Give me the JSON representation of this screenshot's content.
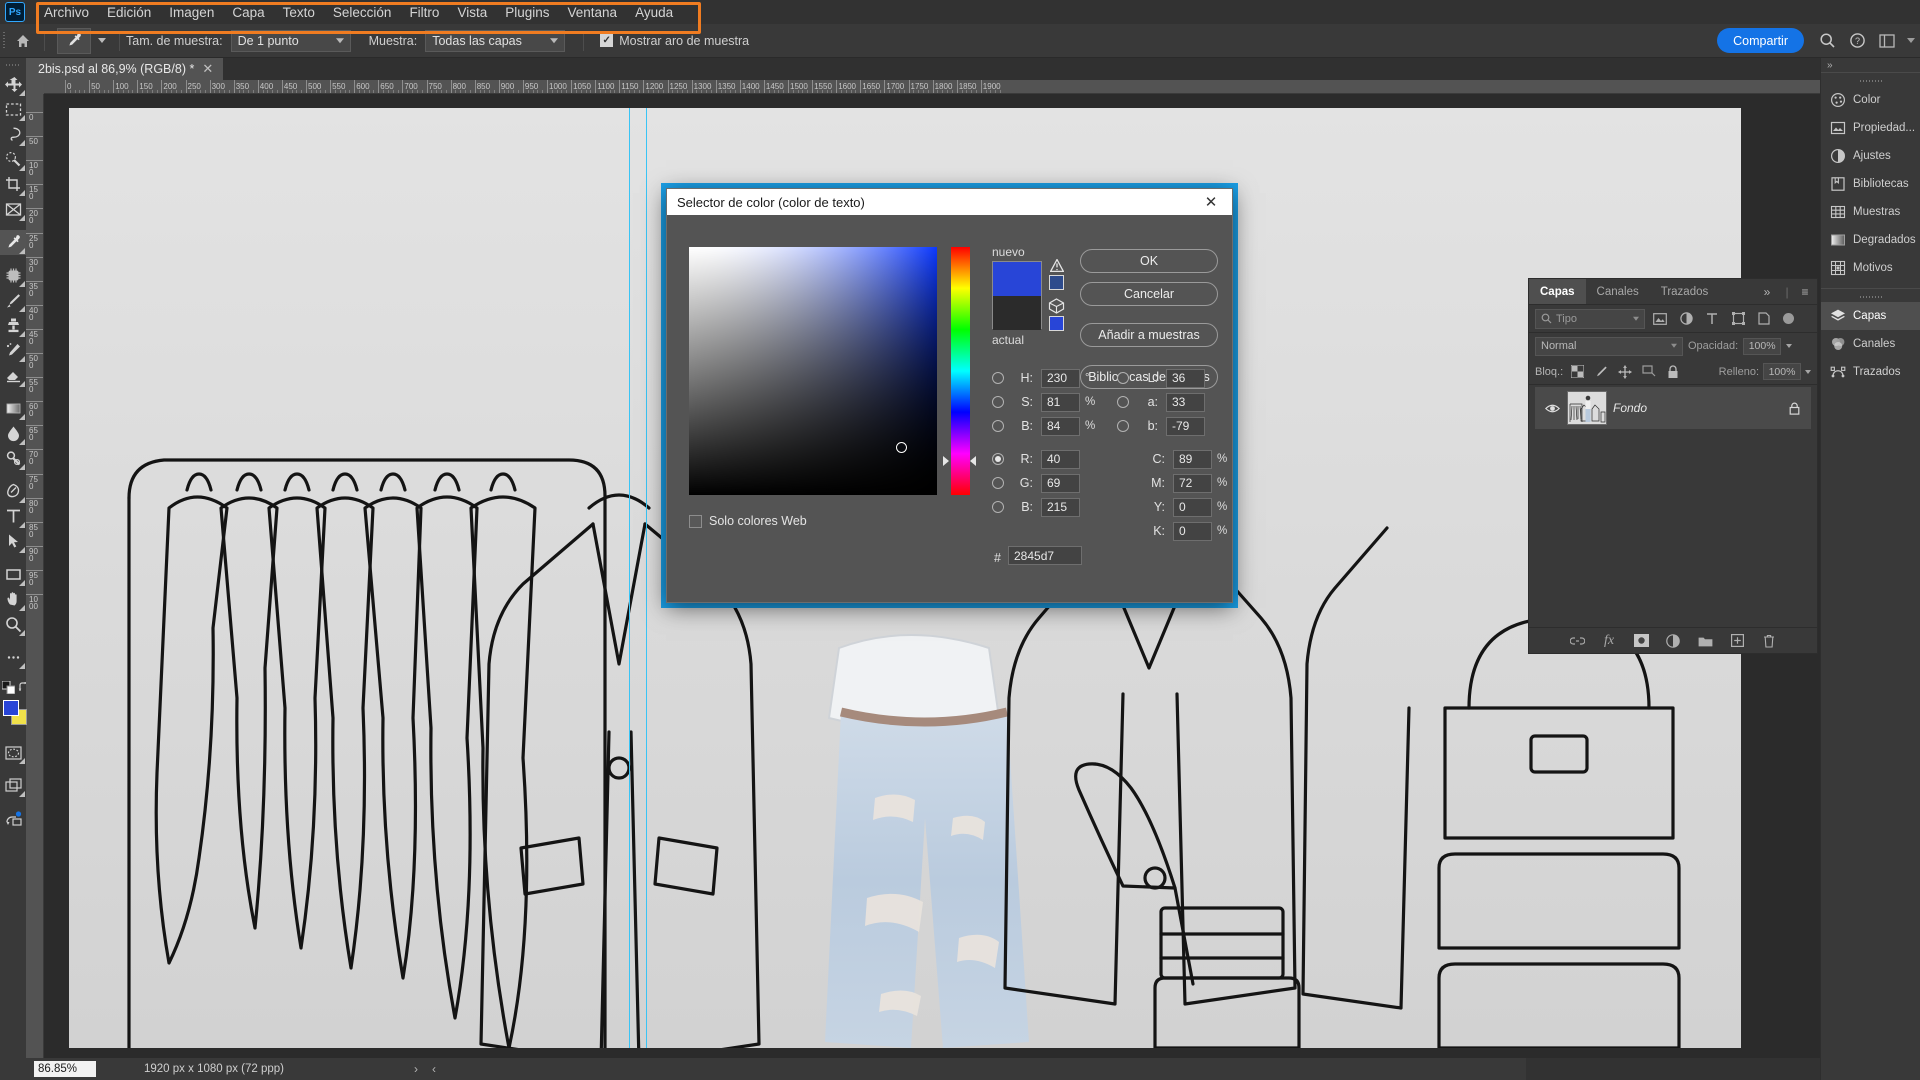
{
  "app": {
    "logo": "Ps"
  },
  "menubar": {
    "items": [
      {
        "label": "Archivo"
      },
      {
        "label": "Edición"
      },
      {
        "label": "Imagen"
      },
      {
        "label": "Capa"
      },
      {
        "label": "Texto"
      },
      {
        "label": "Selección"
      },
      {
        "label": "Filtro"
      },
      {
        "label": "Vista"
      },
      {
        "label": "Plugins"
      },
      {
        "label": "Ventana"
      },
      {
        "label": "Ayuda"
      }
    ]
  },
  "options_bar": {
    "tool": "eyedropper-tool",
    "sample_size_label": "Tam. de muestra:",
    "sample_size_value": "De 1 punto",
    "sample_label": "Muestra:",
    "sample_value": "Todas las capas",
    "show_ring_label": "Mostrar aro de muestra",
    "show_ring_checked": true,
    "share_label": "Compartir",
    "highlight_color": "#f07c21"
  },
  "document": {
    "tab_title": "2bis.psd al 86,9% (RGB/8) *",
    "close_glyph": "✕"
  },
  "rulers": {
    "horizontal_ticks": [
      "0",
      "50",
      "100",
      "150",
      "200",
      "250",
      "300",
      "350",
      "400",
      "450",
      "500",
      "550",
      "600",
      "650",
      "700",
      "750",
      "800",
      "850",
      "900",
      "950",
      "1000",
      "1050",
      "1100",
      "1150",
      "1200",
      "1250",
      "1300",
      "1350",
      "1400",
      "1450",
      "1500",
      "1550",
      "1600",
      "1650",
      "1700",
      "1750",
      "1800",
      "1850",
      "1900"
    ],
    "vertical_ticks": [
      "0",
      "50",
      "100",
      "150",
      "200",
      "250",
      "300",
      "350",
      "400",
      "450",
      "500",
      "550",
      "600",
      "650",
      "700",
      "750",
      "800",
      "850",
      "900",
      "950",
      "1000"
    ]
  },
  "toolbar": {
    "tools": [
      {
        "name": "move-tool",
        "selected": false
      },
      {
        "name": "rectangular-marquee-tool",
        "selected": false
      },
      {
        "name": "lasso-tool",
        "selected": false
      },
      {
        "name": "quick-selection-tool",
        "selected": false
      },
      {
        "name": "crop-tool",
        "selected": false
      },
      {
        "name": "frame-tool",
        "selected": false
      },
      {
        "name": "eyedropper-tool",
        "selected": true
      },
      {
        "name": "spot-healing-brush-tool",
        "selected": false
      },
      {
        "name": "brush-tool",
        "selected": false
      },
      {
        "name": "clone-stamp-tool",
        "selected": false
      },
      {
        "name": "history-brush-tool",
        "selected": false
      },
      {
        "name": "eraser-tool",
        "selected": false
      },
      {
        "name": "gradient-tool",
        "selected": false
      },
      {
        "name": "blur-tool",
        "selected": false
      },
      {
        "name": "dodge-tool",
        "selected": false
      },
      {
        "name": "pen-tool",
        "selected": false
      },
      {
        "name": "type-tool",
        "selected": false
      },
      {
        "name": "path-selection-tool",
        "selected": false
      },
      {
        "name": "rectangle-tool",
        "selected": false
      },
      {
        "name": "hand-tool",
        "selected": false
      },
      {
        "name": "zoom-tool",
        "selected": false
      },
      {
        "name": "edit-toolbar-tool",
        "selected": false
      }
    ],
    "foreground_color": "#2845d7",
    "background_color": "#f0e14a"
  },
  "color_picker": {
    "title": "Selector de color (color de texto)",
    "close_glyph": "✕",
    "new_label": "nuevo",
    "current_label": "actual",
    "new_color": "#2845d7",
    "current_color": "#2b2b2b",
    "out_of_gamut_swatch": "#2e4b8c",
    "web_safe_swatch": "#2845d7",
    "buttons": [
      {
        "label": "OK",
        "name": "ok-button"
      },
      {
        "label": "Cancelar",
        "name": "cancel-button"
      },
      {
        "label": "Añadir a muestras",
        "name": "add-to-swatches-button"
      },
      {
        "label": "Bibliotecas de colores",
        "name": "color-libraries-button"
      }
    ],
    "web_only_label": "Solo colores Web",
    "web_only_checked": false,
    "hex_label": "#",
    "hex_value": "2845d7",
    "selected_model": "R",
    "fields": {
      "hsb": [
        {
          "key": "H",
          "label": "H:",
          "value": "230",
          "unit": "°",
          "selected": false
        },
        {
          "key": "S",
          "label": "S:",
          "value": "81",
          "unit": "%",
          "selected": false
        },
        {
          "key": "B",
          "label": "B:",
          "value": "84",
          "unit": "%",
          "selected": false
        }
      ],
      "rgb": [
        {
          "key": "R",
          "label": "R:",
          "value": "40",
          "unit": "",
          "selected": true
        },
        {
          "key": "G",
          "label": "G:",
          "value": "69",
          "unit": "",
          "selected": false
        },
        {
          "key": "B2",
          "label": "B:",
          "value": "215",
          "unit": "",
          "selected": false
        }
      ],
      "lab": [
        {
          "key": "L",
          "label": "L:",
          "value": "36",
          "unit": "",
          "selected": false
        },
        {
          "key": "a",
          "label": "a:",
          "value": "33",
          "unit": "",
          "selected": false
        },
        {
          "key": "b",
          "label": "b:",
          "value": "-79",
          "unit": "",
          "selected": false
        }
      ],
      "cmyk": [
        {
          "key": "C",
          "label": "C:",
          "value": "89",
          "unit": "%"
        },
        {
          "key": "M",
          "label": "M:",
          "value": "72",
          "unit": "%"
        },
        {
          "key": "Y",
          "label": "Y:",
          "value": "0",
          "unit": "%"
        },
        {
          "key": "K",
          "label": "K:",
          "value": "0",
          "unit": "%"
        }
      ]
    },
    "outline_color": "#1ba0e8"
  },
  "layers_panel": {
    "tabs": [
      {
        "label": "Capas",
        "active": true
      },
      {
        "label": "Canales",
        "active": false
      },
      {
        "label": "Trazados",
        "active": false
      }
    ],
    "expand_glyph": "»",
    "menu_glyph": "≡",
    "filter_placeholder": "Tipo",
    "filter_icons": [
      "image-filter-icon",
      "adjustment-filter-icon",
      "text-filter-icon",
      "shape-filter-icon",
      "smart-object-filter-icon"
    ],
    "blend_mode": "Normal",
    "opacity_label": "Opacidad:",
    "opacity_value": "100%",
    "lock_label": "Bloq.:",
    "lock_icons": [
      "lock-transparency-icon",
      "lock-image-icon",
      "lock-position-icon",
      "lock-artboard-icon",
      "lock-all-icon"
    ],
    "fill_label": "Relleno:",
    "fill_value": "100%",
    "layers": [
      {
        "name": "Fondo",
        "visible": true,
        "locked": true
      }
    ],
    "bottom_icons": [
      "link-layers-icon",
      "layer-style-fx-icon",
      "layer-mask-icon",
      "adjustment-layer-icon",
      "new-group-icon",
      "new-layer-icon",
      "delete-layer-icon"
    ]
  },
  "right_dock": {
    "collapse_glyph": "»",
    "group1": [
      {
        "label": "Color",
        "icon": "color-panel-icon",
        "active": false
      },
      {
        "label": "Propiedad...",
        "icon": "properties-panel-icon",
        "active": false
      },
      {
        "label": "Ajustes",
        "icon": "adjustments-panel-icon",
        "active": false
      },
      {
        "label": "Bibliotecas",
        "icon": "libraries-panel-icon",
        "active": false
      },
      {
        "label": "Muestras",
        "icon": "swatches-panel-icon",
        "active": false
      },
      {
        "label": "Degradados",
        "icon": "gradients-panel-icon",
        "active": false
      },
      {
        "label": "Motivos",
        "icon": "patterns-panel-icon",
        "active": false
      }
    ],
    "group2": [
      {
        "label": "Capas",
        "icon": "layers-panel-icon",
        "active": true
      },
      {
        "label": "Canales",
        "icon": "channels-panel-icon",
        "active": false
      },
      {
        "label": "Trazados",
        "icon": "paths-panel-icon",
        "active": false
      }
    ]
  },
  "status_bar": {
    "zoom": "86.85%",
    "dimensions": "1920 px x 1080 px (72 ppp)",
    "next_glyph": "›",
    "prev_glyph": "‹"
  }
}
